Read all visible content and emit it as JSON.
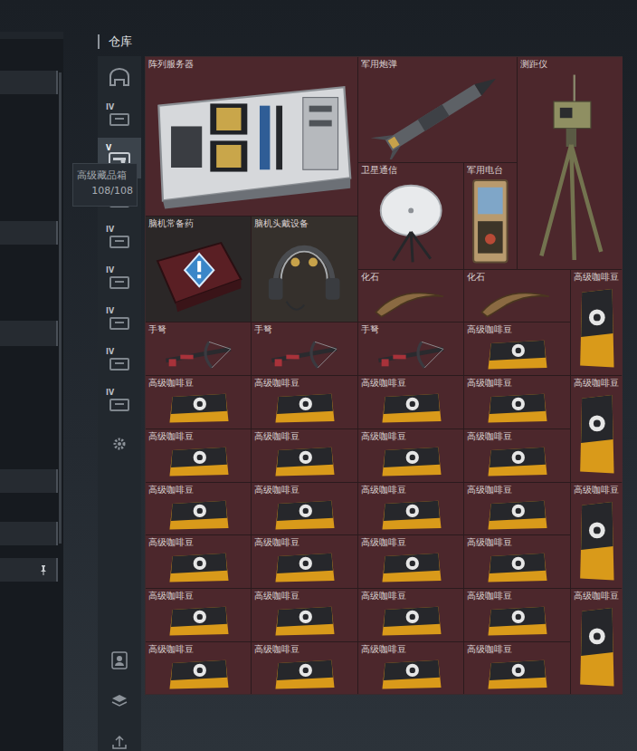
{
  "warehouse": {
    "title": "仓库"
  },
  "tabs": [
    {
      "kind": "home",
      "selected": false
    },
    {
      "kind": "case",
      "badge": "IV",
      "selected": false
    },
    {
      "kind": "gun",
      "badge": "V",
      "selected": true
    },
    {
      "kind": "case",
      "selected": false
    },
    {
      "kind": "case",
      "badge": "IV",
      "selected": false
    },
    {
      "kind": "case",
      "badge": "IV",
      "selected": false
    },
    {
      "kind": "case",
      "badge": "IV",
      "selected": false
    },
    {
      "kind": "case",
      "badge": "IV",
      "selected": false
    },
    {
      "kind": "case",
      "badge": "IV",
      "selected": false
    },
    {
      "kind": "gear",
      "selected": false
    }
  ],
  "bottom_tabs": [
    {
      "kind": "person"
    },
    {
      "kind": "layers"
    },
    {
      "kind": "export"
    }
  ],
  "tooltip": {
    "title": "高级藏品箱",
    "count": "108/108"
  },
  "items": [
    {
      "label": "阵列服务器",
      "kind": "server",
      "color": "#4c272c"
    },
    {
      "label": "军用炮弹",
      "kind": "shell",
      "color": "#4c272c"
    },
    {
      "label": "测距仪",
      "kind": "rangefinder",
      "color": "#4c272c"
    },
    {
      "label": "卫星通信",
      "kind": "satellite",
      "color": "#4c272c"
    },
    {
      "label": "军用电台",
      "kind": "radio",
      "color": "#4c272c"
    },
    {
      "label": "脑机常备药",
      "kind": "medkit",
      "color": "#2b2727"
    },
    {
      "label": "脑机头戴设备",
      "kind": "headset",
      "color": "#35302c"
    },
    {
      "label": "化石",
      "kind": "fossil",
      "color": "#4c272c"
    },
    {
      "label": "化石",
      "kind": "fossil",
      "color": "#4c272c"
    },
    {
      "label": "高级咖啡豆",
      "kind": "coffee-tall",
      "color": "#4c272c"
    },
    {
      "label": "手弩",
      "kind": "crossbow",
      "color": "#4c272c"
    },
    {
      "label": "手弩",
      "kind": "crossbow",
      "color": "#4c272c"
    },
    {
      "label": "手弩",
      "kind": "crossbow",
      "color": "#4c272c"
    },
    {
      "label": "高级咖啡豆",
      "kind": "coffee",
      "color": "#4c272c"
    },
    {
      "label": "高级咖啡豆",
      "kind": "coffee",
      "color": "#4c272c"
    },
    {
      "label": "高级咖啡豆",
      "kind": "coffee",
      "color": "#4c272c"
    },
    {
      "label": "高级咖啡豆",
      "kind": "coffee",
      "color": "#4c272c"
    },
    {
      "label": "高级咖啡豆",
      "kind": "coffee",
      "color": "#4c272c"
    },
    {
      "label": "高级咖啡豆",
      "kind": "coffee-tall",
      "color": "#4c272c"
    },
    {
      "label": "高级咖啡豆",
      "kind": "coffee",
      "color": "#4c272c"
    },
    {
      "label": "高级咖啡豆",
      "kind": "coffee",
      "color": "#4c272c"
    },
    {
      "label": "高级咖啡豆",
      "kind": "coffee",
      "color": "#4c272c"
    },
    {
      "label": "高级咖啡豆",
      "kind": "coffee",
      "color": "#4c272c"
    },
    {
      "label": "高级咖啡豆",
      "kind": "coffee",
      "color": "#4c272c"
    },
    {
      "label": "高级咖啡豆",
      "kind": "coffee",
      "color": "#4c272c"
    },
    {
      "label": "高级咖啡豆",
      "kind": "coffee",
      "color": "#4c272c"
    },
    {
      "label": "高级咖啡豆",
      "kind": "coffee",
      "color": "#4c272c"
    },
    {
      "label": "高级咖啡豆",
      "kind": "coffee-tall",
      "color": "#4c272c"
    },
    {
      "label": "高级咖啡豆",
      "kind": "coffee",
      "color": "#4c272c"
    },
    {
      "label": "高级咖啡豆",
      "kind": "coffee",
      "color": "#4c272c"
    },
    {
      "label": "高级咖啡豆",
      "kind": "coffee",
      "color": "#4c272c"
    },
    {
      "label": "高级咖啡豆",
      "kind": "coffee",
      "color": "#4c272c"
    },
    {
      "label": "高级咖啡豆",
      "kind": "coffee",
      "color": "#4c272c"
    },
    {
      "label": "高级咖啡豆",
      "kind": "coffee",
      "color": "#4c272c"
    },
    {
      "label": "高级咖啡豆",
      "kind": "coffee",
      "color": "#4c272c"
    },
    {
      "label": "高级咖啡豆",
      "kind": "coffee",
      "color": "#4c272c"
    },
    {
      "label": "高级咖啡豆",
      "kind": "coffee-tall",
      "color": "#4c272c"
    },
    {
      "label": "高级咖啡豆",
      "kind": "coffee",
      "color": "#4c272c"
    },
    {
      "label": "高级咖啡豆",
      "kind": "coffee",
      "color": "#4c272c"
    },
    {
      "label": "高级咖啡豆",
      "kind": "coffee",
      "color": "#4c272c"
    },
    {
      "label": "高级咖啡豆",
      "kind": "coffee",
      "color": "#4c272c"
    }
  ]
}
